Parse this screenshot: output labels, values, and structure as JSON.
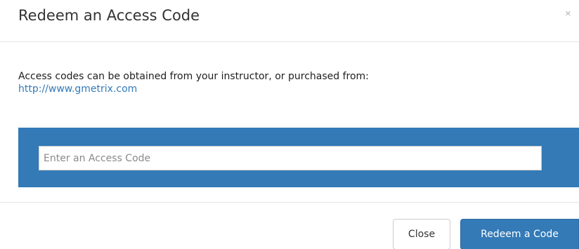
{
  "modal": {
    "title": "Redeem an Access Code",
    "close_glyph": "×",
    "close_icon": "close-icon",
    "info_text": "Access codes can be obtained from your instructor, or purchased from:",
    "link_text": "http://www.gmetrix.com",
    "input": {
      "placeholder": "Enter an Access Code",
      "value": ""
    },
    "footer": {
      "close_label": "Close",
      "redeem_label": "Redeem a Code"
    },
    "colors": {
      "accent": "#337ab7",
      "link": "#337ab7",
      "divider": "#e5e5e5"
    }
  }
}
